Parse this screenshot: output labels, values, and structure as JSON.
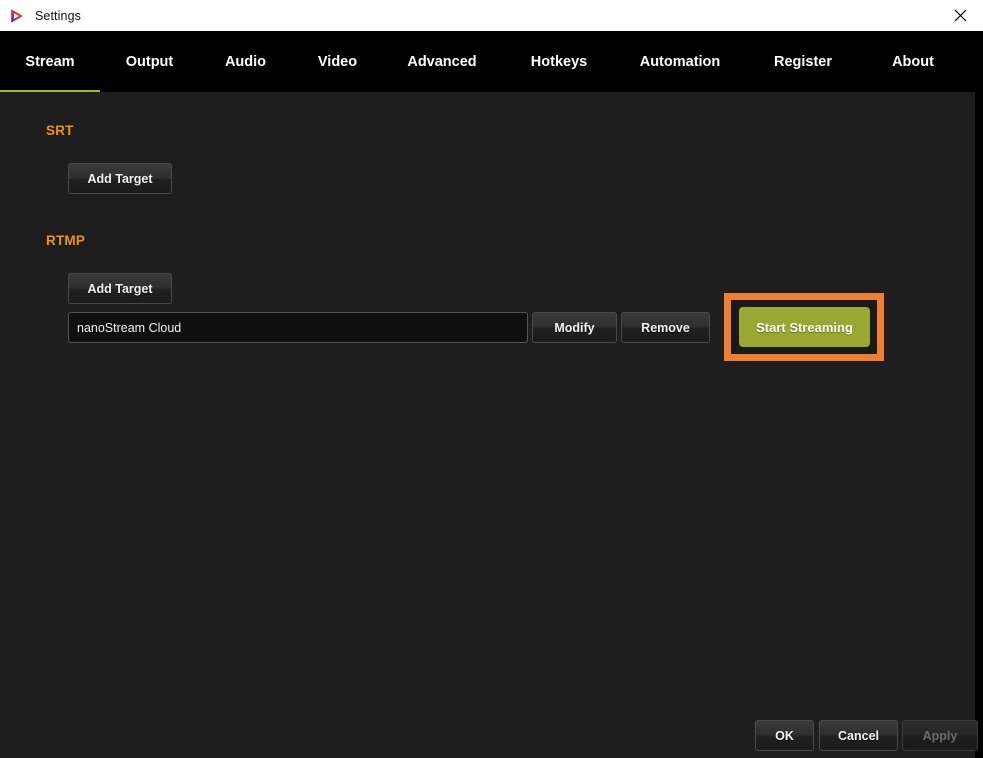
{
  "window": {
    "title": "Settings",
    "logo_icon": "play-triangle-logo",
    "close_icon": "close-icon",
    "close_label": "Close"
  },
  "tabs": [
    {
      "label": "Stream",
      "key": "stream",
      "active": true
    },
    {
      "label": "Output",
      "key": "output",
      "active": false
    },
    {
      "label": "Audio",
      "key": "audio",
      "active": false
    },
    {
      "label": "Video",
      "key": "video",
      "active": false
    },
    {
      "label": "Advanced",
      "key": "advanced",
      "active": false
    },
    {
      "label": "Hotkeys",
      "key": "hotkeys",
      "active": false
    },
    {
      "label": "Automation",
      "key": "automation",
      "active": false
    },
    {
      "label": "Register",
      "key": "register",
      "active": false
    },
    {
      "label": "About",
      "key": "about",
      "active": false
    }
  ],
  "stream_tab": {
    "srt": {
      "section_label": "SRT",
      "add_target_label": "Add Target"
    },
    "rtmp": {
      "section_label": "RTMP",
      "add_target_label": "Add Target",
      "target": {
        "name": "nanoStream Cloud",
        "placeholder": "",
        "modify_label": "Modify",
        "remove_label": "Remove"
      }
    },
    "start_streaming": {
      "label": "Start Streaming",
      "highlighted": true
    }
  },
  "footer": {
    "ok_label": "OK",
    "cancel_label": "Cancel",
    "apply_label": "Apply",
    "apply_disabled": true
  },
  "colors": {
    "accent_green": "#9aa832",
    "section_orange": "#ef9310",
    "annotation_orange": "#ee8030",
    "tab_underline": "#a8b81f",
    "panel_bg": "#1e1e1e",
    "tabbar_bg": "#000000",
    "titlebar_bg": "#ffffff"
  }
}
